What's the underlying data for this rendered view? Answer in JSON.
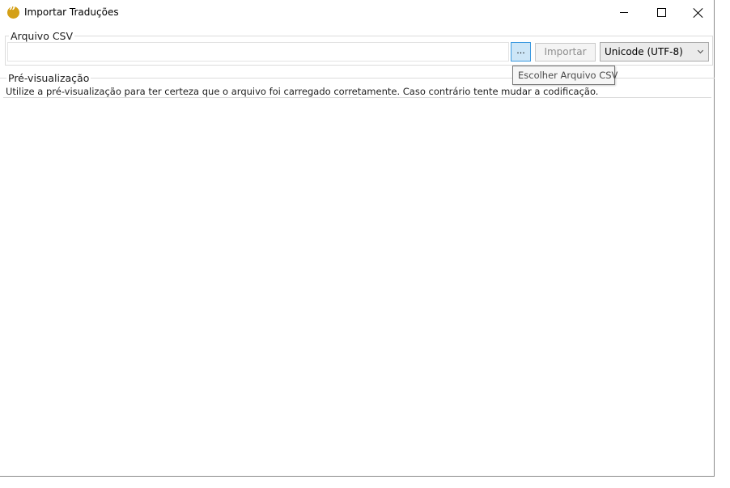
{
  "window": {
    "title": "Importar Traduções",
    "app_icon": "speech-bubble-quote-icon",
    "controls": {
      "minimize": "minimize-icon",
      "maximize": "maximize-icon",
      "close": "close-icon"
    }
  },
  "csv_group": {
    "label": "Arquivo CSV",
    "file_path": "",
    "browse_label": "...",
    "browse_tooltip": "Escolher Arquivo CSV",
    "import_label": "Importar",
    "encoding_selected": "Unicode (UTF-8)"
  },
  "preview_group": {
    "label": "Pré-visualização",
    "description": "Utilize a pré-visualização para ter certeza que o arquivo foi carregado corretamente. Caso contrário tente mudar a codificação."
  },
  "colors": {
    "accent": "#3c9ae0",
    "app_icon": "#d4a017"
  }
}
